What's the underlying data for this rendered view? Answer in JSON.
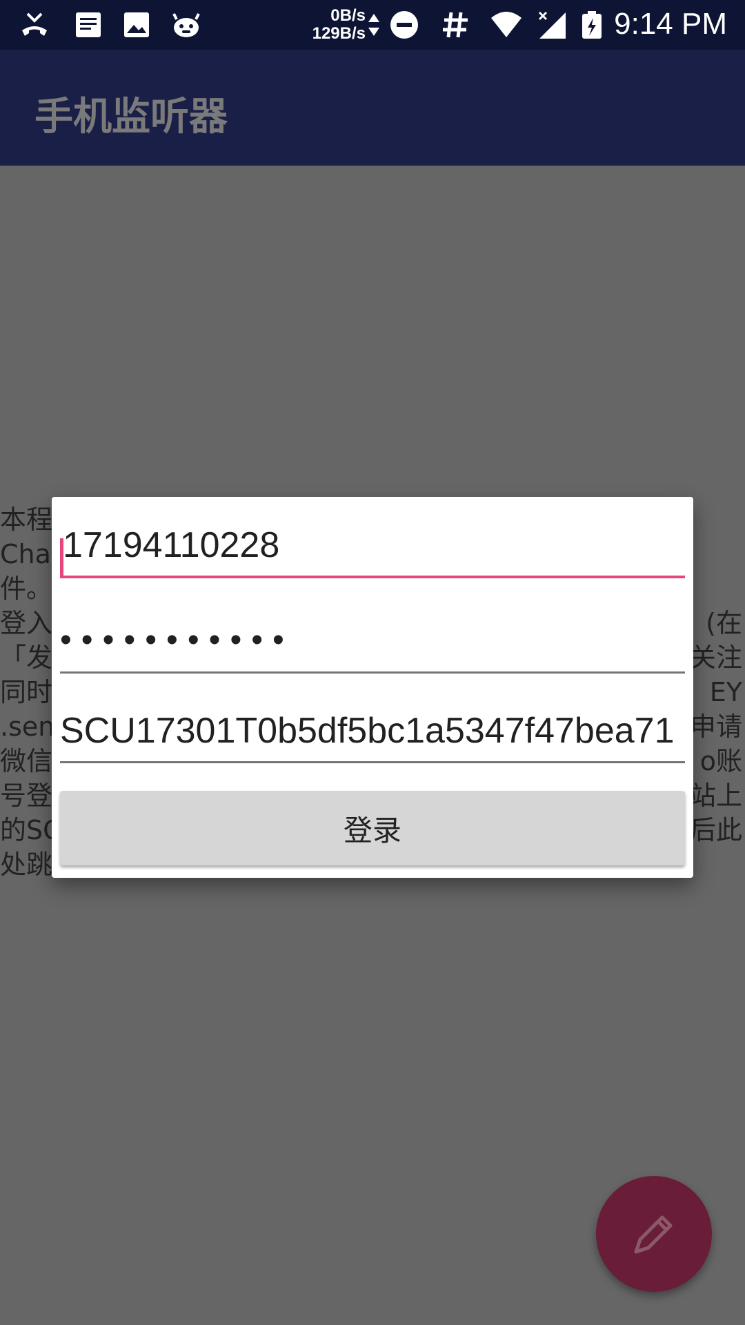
{
  "status_bar": {
    "net_down": "0B/s",
    "net_up": "129B/s",
    "time": "9:14 PM",
    "icons": [
      "missed-call-icon",
      "notes-icon",
      "image-icon",
      "bug-icon",
      "net-speed-arrows-icon",
      "dnd-icon",
      "hash-icon",
      "wifi-icon",
      "signal-icon",
      "battery-charging-icon"
    ]
  },
  "app_bar": {
    "title": "手机监听器"
  },
  "background_text": {
    "lines_left": [
      "本程",
      "Cha",
      "件。",
      "登入",
      "「发",
      "同时",
      ".sen",
      "微信",
      "号登",
      "的SC",
      "处跳"
    ],
    "lines_right": [
      "",
      "",
      "",
      "(在",
      "关注",
      "EY",
      "申请",
      "o账",
      "站上",
      "后此",
      ""
    ]
  },
  "dialog": {
    "phone_value": "17194110228",
    "password_value": "•••••••••••",
    "key_value": "SCU17301T0b5df5bc1a5347f47bea71",
    "login_label": "登录"
  },
  "fab": {
    "icon": "pencil-icon"
  },
  "colors": {
    "accent": "#e8467a",
    "primary_dark": "#0e1433",
    "primary": "#1a1f48",
    "fab": "#6a1d38"
  }
}
